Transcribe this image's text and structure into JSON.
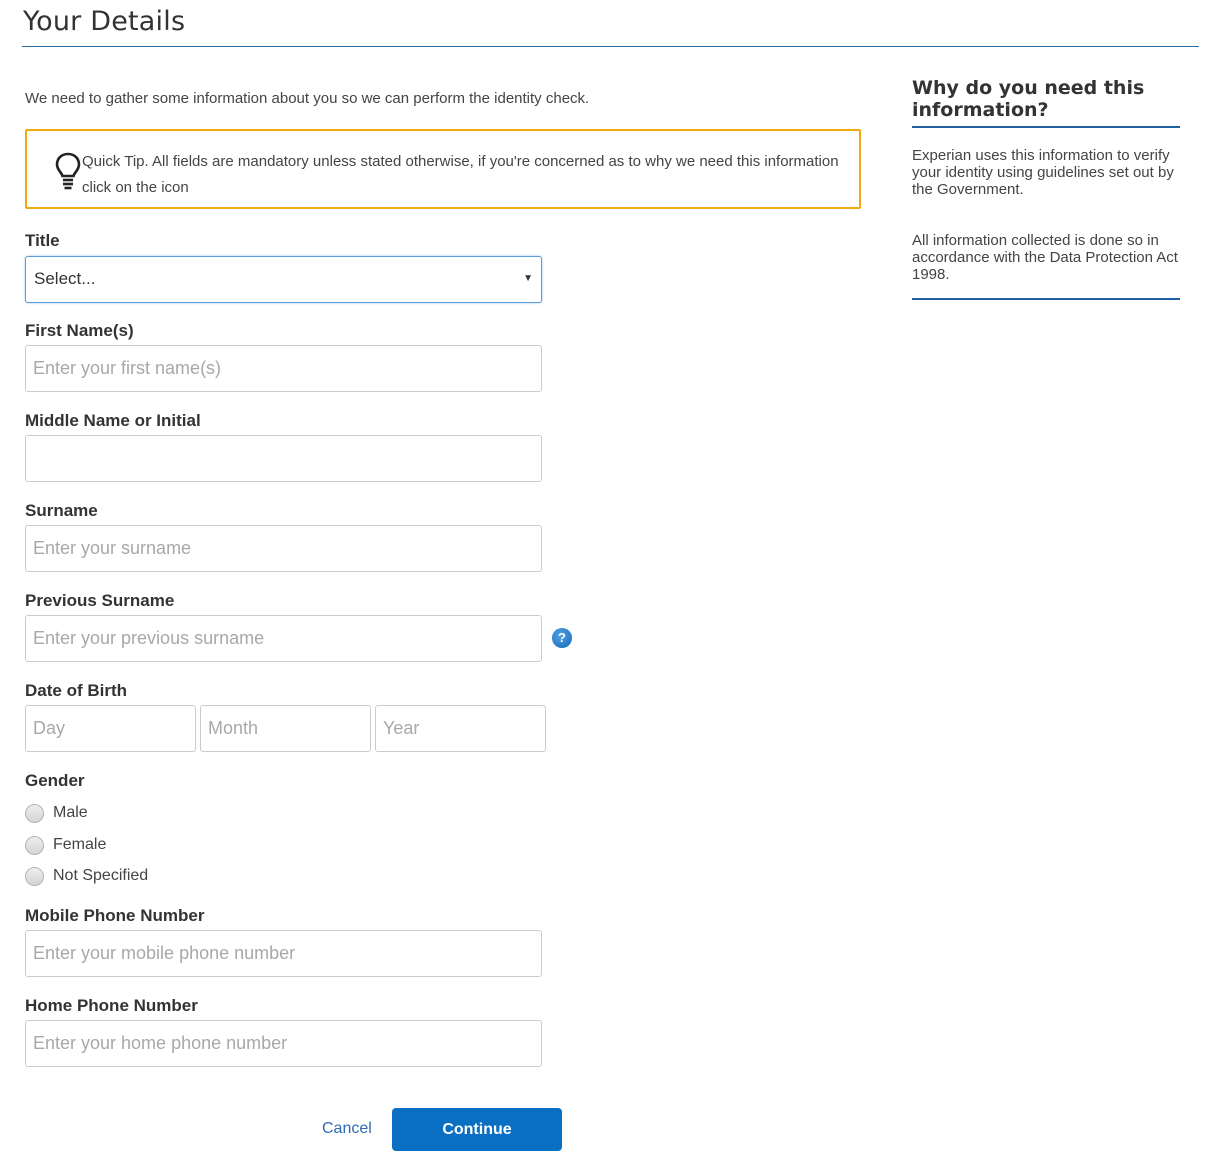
{
  "header": {
    "title": "Your Details"
  },
  "intro": "We need to gather some information about you so we can perform the identity check.",
  "tip": {
    "text": "Quick Tip. All fields are mandatory unless stated otherwise, if you're concerned as to why we need this information click on the icon",
    "icon": "lightbulb-icon",
    "border_color": "#f0a90e"
  },
  "form": {
    "title": {
      "label": "Title",
      "value": "Select..."
    },
    "first_name": {
      "label": "First Name(s)",
      "placeholder": "Enter your first name(s)"
    },
    "middle_name": {
      "label": "Middle Name or Initial",
      "placeholder": ""
    },
    "surname": {
      "label": "Surname",
      "placeholder": "Enter your surname"
    },
    "previous_surname": {
      "label": "Previous Surname",
      "placeholder": "Enter your previous surname",
      "help_icon": "?"
    },
    "dob": {
      "label": "Date of Birth",
      "day_placeholder": "Day",
      "month_placeholder": "Month",
      "year_placeholder": "Year"
    },
    "gender": {
      "label": "Gender",
      "options": [
        "Male",
        "Female",
        "Not Specified"
      ]
    },
    "mobile": {
      "label": "Mobile Phone Number",
      "placeholder": "Enter your mobile phone number"
    },
    "home_phone": {
      "label": "Home Phone Number",
      "placeholder": "Enter your home phone number"
    }
  },
  "actions": {
    "cancel_label": "Cancel",
    "continue_label": "Continue",
    "primary_color": "#0a6fc2"
  },
  "sidebar": {
    "heading": "Why do you need this information?",
    "paragraphs": [
      "Experian uses this information to verify your identity using guidelines set out by the Government.",
      "All information collected is done so in accordance with the Data Protection Act 1998."
    ],
    "accent_color": "#1f5f9e"
  }
}
